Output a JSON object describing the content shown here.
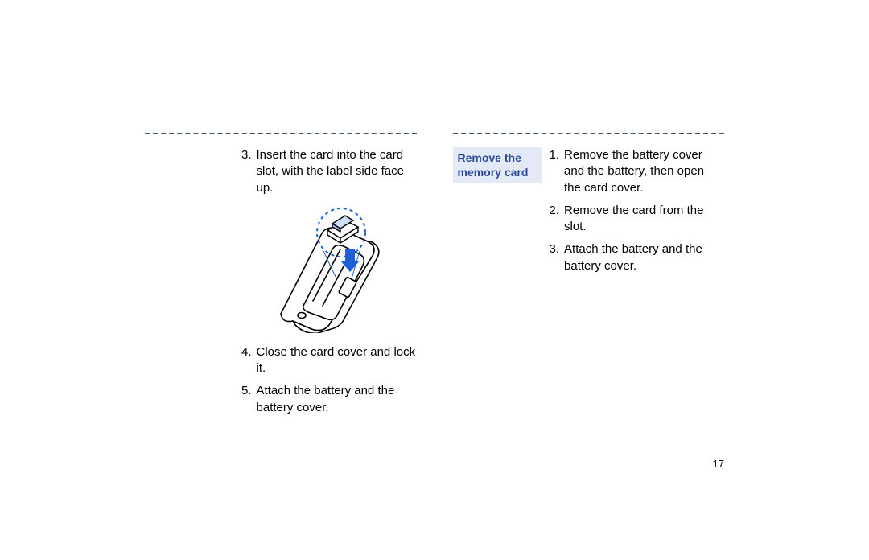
{
  "left": {
    "steps": [
      {
        "n": "3.",
        "t": "Insert the card into the card slot, with the label side face up."
      },
      {
        "n": "4.",
        "t": "Close the card cover and lock it."
      },
      {
        "n": "5.",
        "t": "Attach the battery and the battery cover."
      }
    ]
  },
  "right": {
    "heading_l1": "Remove the",
    "heading_l2": "memory card",
    "steps": [
      {
        "n": "1.",
        "t": "Remove the battery cover and the battery, then open the card cover."
      },
      {
        "n": "2.",
        "t": "Remove the card from the slot."
      },
      {
        "n": "3.",
        "t": "Attach the battery and the battery cover."
      }
    ]
  },
  "page_number": "17"
}
